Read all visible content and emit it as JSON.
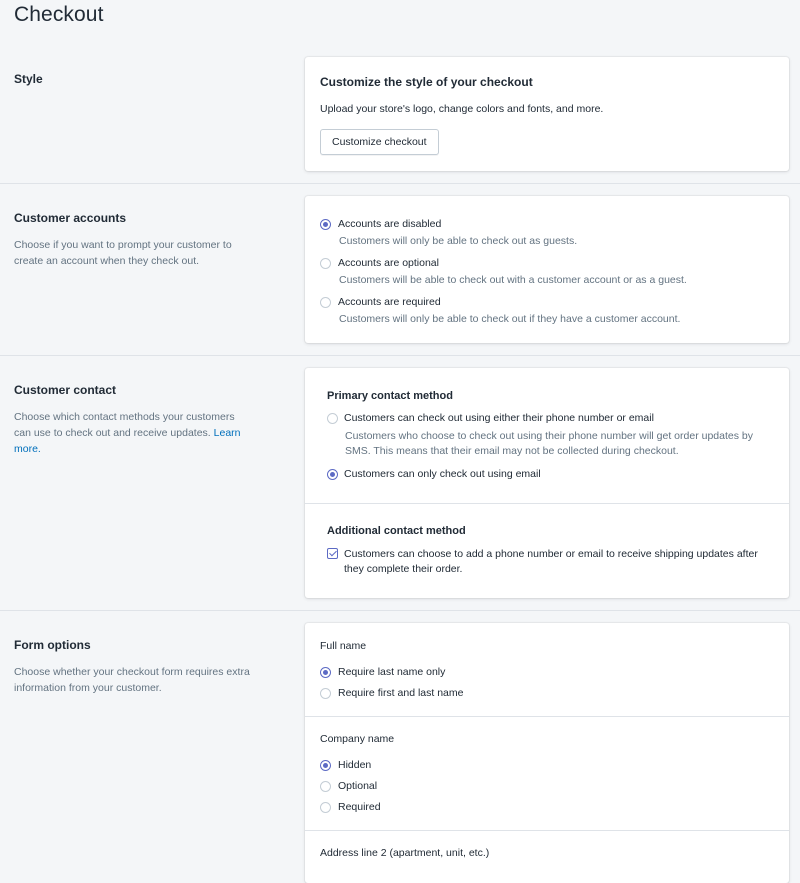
{
  "page": {
    "title": "Checkout"
  },
  "style": {
    "section_title": "Style",
    "card_heading": "Customize the style of your checkout",
    "card_text": "Upload your store's logo, change colors and fonts, and more.",
    "button_label": "Customize checkout"
  },
  "accounts": {
    "section_title": "Customer accounts",
    "description": "Choose if you want to prompt your customer to create an account when they check out.",
    "options": [
      {
        "label": "Accounts are disabled",
        "help": "Customers will only be able to check out as guests.",
        "selected": true
      },
      {
        "label": "Accounts are optional",
        "help": "Customers will be able to check out with a customer account or as a guest.",
        "selected": false
      },
      {
        "label": "Accounts are required",
        "help": "Customers will only be able to check out if they have a customer account.",
        "selected": false
      }
    ]
  },
  "contact": {
    "section_title": "Customer contact",
    "description": "Choose which contact methods your customers can use to check out and receive updates.",
    "learn_more": "Learn more.",
    "primary_heading": "Primary contact method",
    "primary_options": [
      {
        "label": "Customers can check out using either their phone number or email",
        "help_line1": "Customers who choose to check out using their phone number will get order updates by",
        "help_line2": "SMS. This means that their email may not be collected during checkout.",
        "selected": false
      },
      {
        "label": "Customers can only check out using email",
        "selected": true
      }
    ],
    "additional_heading": "Additional contact method",
    "additional_line1": "Customers can choose to add a phone number or email to receive shipping updates after",
    "additional_line2": "they complete their order.",
    "additional_checked": true
  },
  "form": {
    "section_title": "Form options",
    "description": "Choose whether your checkout form requires extra information from your customer.",
    "full_name": {
      "label": "Full name",
      "options": [
        {
          "label": "Require last name only",
          "selected": true
        },
        {
          "label": "Require first and last name",
          "selected": false
        }
      ]
    },
    "company_name": {
      "label": "Company name",
      "options": [
        {
          "label": "Hidden",
          "selected": true
        },
        {
          "label": "Optional",
          "selected": false
        },
        {
          "label": "Required",
          "selected": false
        }
      ]
    },
    "address_line2": {
      "label": "Address line 2 (apartment, unit, etc.)"
    }
  },
  "colors": {
    "accent": "#5c6ac4",
    "link": "#006fbb",
    "background": "#f4f6f8",
    "muted_text": "#637381"
  }
}
